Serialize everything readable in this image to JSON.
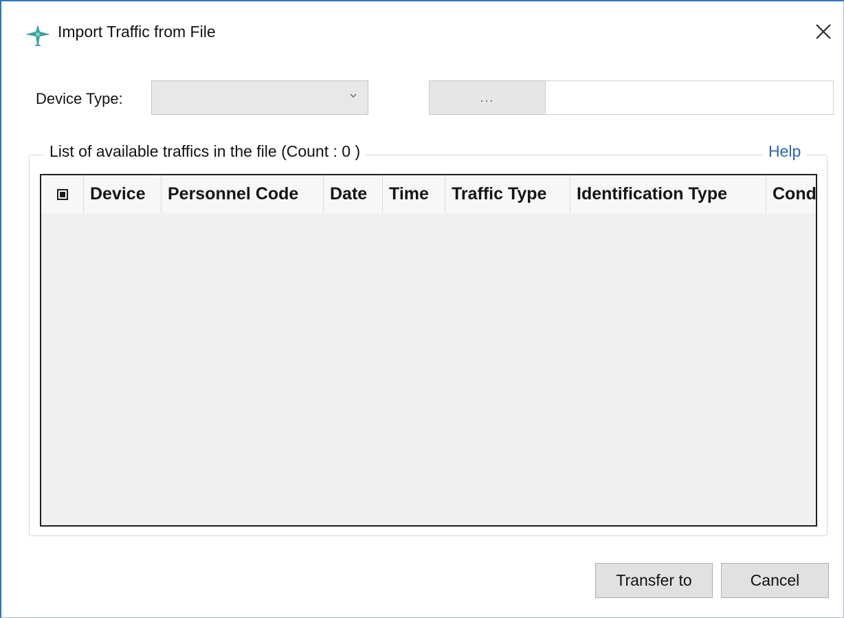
{
  "window": {
    "title": "Import Traffic from File",
    "accent_color": "#2b74c8"
  },
  "form": {
    "device_type_label": "Device Type:",
    "device_type_value": "",
    "browse_label": "...",
    "file_path_value": ""
  },
  "group": {
    "title": "List of available traffics in the file (Count : 0  )",
    "help_label": "Help"
  },
  "grid": {
    "columns": [
      "Device",
      "Personnel Code",
      "Date",
      "Time",
      "Traffic Type",
      "Identification Type",
      "Cond"
    ],
    "rows": []
  },
  "buttons": {
    "transfer_label": "Transfer to",
    "cancel_label": "Cancel"
  },
  "icons": {
    "app": "plane-icon",
    "close": "close-icon",
    "dropdown": "chevron-down-icon"
  }
}
